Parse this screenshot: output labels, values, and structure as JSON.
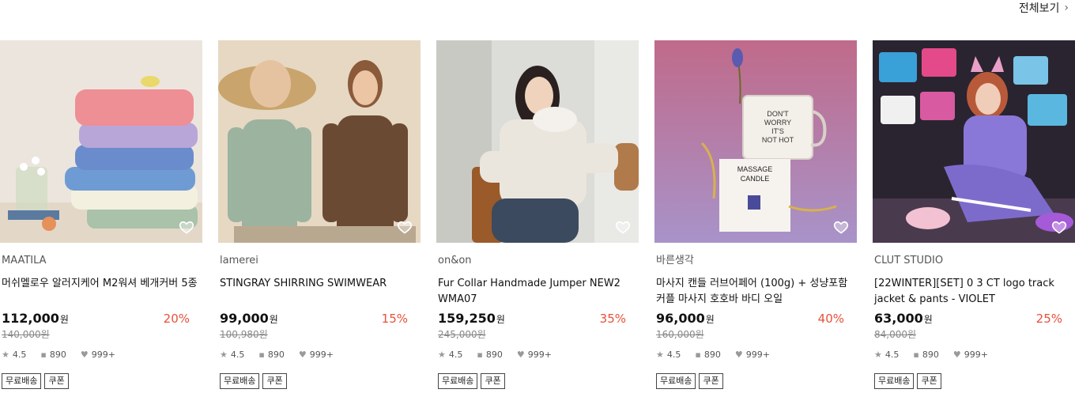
{
  "section": {
    "view_all_label": "전체보기"
  },
  "products": [
    {
      "brand": "MAATILA",
      "title": "머쉬멜로우 알러지케어 M2워셔 베개커버 5종",
      "price": "112,000",
      "currency": "원",
      "discount": "20%",
      "original_price": "140,000원",
      "rating": "4.5",
      "reviews": "890",
      "likes": "999+",
      "tags": [
        "무료배송",
        "쿠폰"
      ],
      "image": "stacked-pillows"
    },
    {
      "brand": "lamerei",
      "title": "STINGRAY SHIRRING SWIMWEAR",
      "price": "99,000",
      "currency": "원",
      "discount": "15%",
      "original_price": "100,980원",
      "rating": "4.5",
      "reviews": "890",
      "likes": "999+",
      "tags": [
        "무료배송",
        "쿠폰"
      ],
      "image": "two-models-long-sleeve"
    },
    {
      "brand": "on&on",
      "title": "Fur Collar Handmade Jumper NEW2 WMA07",
      "price": "159,250",
      "currency": "원",
      "discount": "35%",
      "original_price": "245,000원",
      "rating": "4.5",
      "reviews": "890",
      "likes": "999+",
      "tags": [
        "무료배송",
        "쿠폰"
      ],
      "image": "model-fur-jacket"
    },
    {
      "brand": "바른생각",
      "title": "마사지 캔들 러브어페어 (100g) + 성냥포함 커플 마사지 호호바 바디 오일",
      "price": "96,000",
      "currency": "원",
      "discount": "40%",
      "original_price": "160,000원",
      "rating": "4.5",
      "reviews": "890",
      "likes": "999+",
      "tags": [
        "무료배송",
        "쿠폰"
      ],
      "image": "massage-candle",
      "image_texts": {
        "jar": [
          "DON'T",
          "WORRY",
          "IT'S",
          "NOT HOT"
        ],
        "box": [
          "MASSAGE",
          "CANDLE"
        ]
      }
    },
    {
      "brand": "CLUT STUDIO",
      "title": "[22WINTER][SET] 0 3 CT logo track jacket & pants - VIOLET",
      "price": "63,000",
      "currency": "원",
      "discount": "25%",
      "original_price": "84,000원",
      "rating": "4.5",
      "reviews": "890",
      "likes": "999+",
      "tags": [
        "무료배송",
        "쿠폰"
      ],
      "image": "model-violet-tracksuit"
    }
  ],
  "icons": {
    "rating": "star-icon",
    "reviews": "comment-icon",
    "likes": "heart-icon",
    "wishlist": "heart-outline-icon",
    "view_all": "chevron-right-icon"
  },
  "colors": {
    "discount": "#e8503a",
    "muted": "#888888"
  }
}
